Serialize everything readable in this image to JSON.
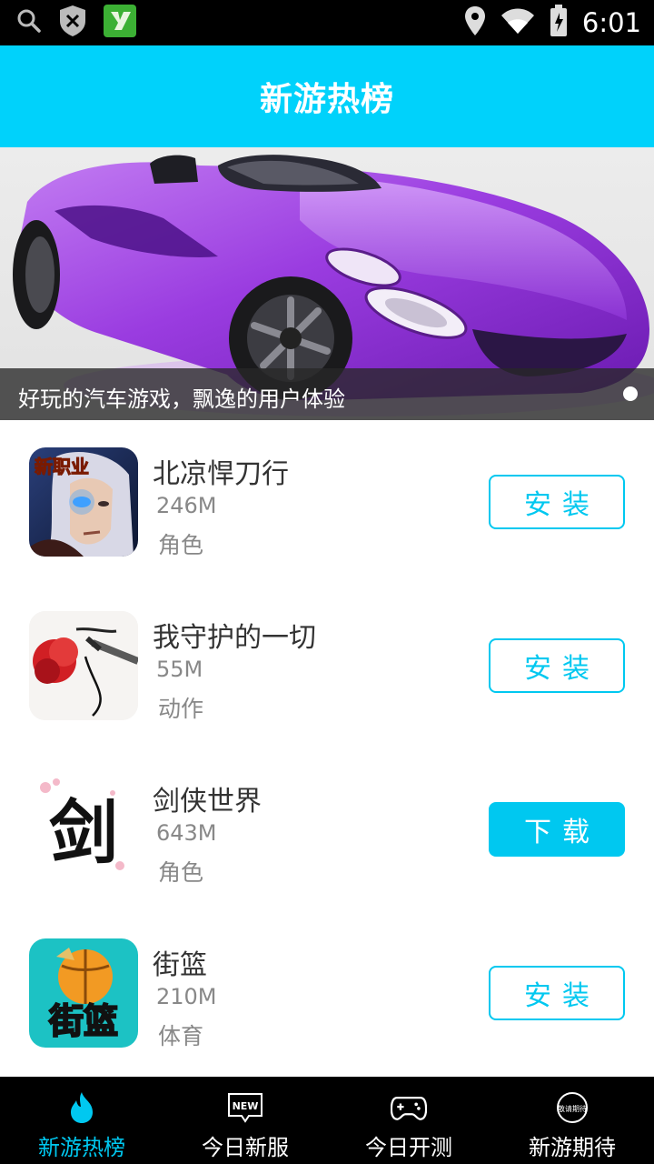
{
  "status_bar": {
    "time": "6:01",
    "icons": [
      "search-icon",
      "shield-icon",
      "app-y-icon",
      "location-icon",
      "wifi-icon",
      "battery-icon"
    ]
  },
  "header": {
    "title": "新游热榜"
  },
  "banner": {
    "caption": "好玩的汽车游戏，飘逸的用户体验",
    "page_index": 1,
    "page_count": 1
  },
  "games": [
    {
      "name": "北凉悍刀行",
      "size": "246M",
      "category": "角色",
      "action": "安装",
      "icon_text": "新职业"
    },
    {
      "name": "我守护的一切",
      "size": "55M",
      "category": "动作",
      "action": "安装"
    },
    {
      "name": "剑侠世界",
      "size": "643M",
      "category": "角色",
      "action": "下载",
      "icon_text": "剑"
    },
    {
      "name": "街篮",
      "size": "210M",
      "category": "体育",
      "action": "安装",
      "icon_text": "街篮"
    }
  ],
  "bottom_nav": [
    {
      "label": "新游热榜",
      "icon": "flame-icon",
      "active": true
    },
    {
      "label": "今日新服",
      "icon": "new-badge-icon",
      "active": false,
      "icon_text": "NEW"
    },
    {
      "label": "今日开测",
      "icon": "gamepad-icon",
      "active": false
    },
    {
      "label": "新游期待",
      "icon": "anticipate-icon",
      "active": false,
      "icon_text": "敬请期待"
    }
  ],
  "colors": {
    "accent": "#00c8f0",
    "header_bg": "#00d2fb",
    "nav_bg": "#000000"
  }
}
